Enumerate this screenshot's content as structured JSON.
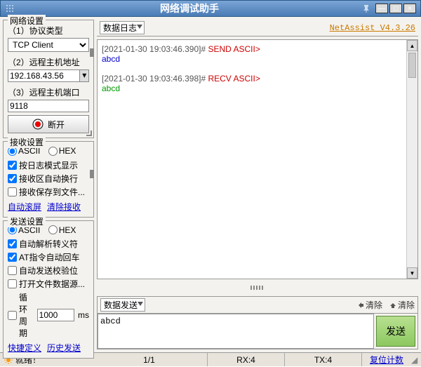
{
  "title": "网络调试助手",
  "version": "NetAssist V4.3.26",
  "net": {
    "group": "网络设置",
    "protoLabel": "（1）协议类型",
    "protoValue": "TCP Client",
    "hostLabel": "（2）远程主机地址",
    "hostValue": "192.168.43.56",
    "portLabel": "（3）远程主机端口",
    "portValue": "9118",
    "disconnect": "断开"
  },
  "recv": {
    "group": "接收设置",
    "ascii": "ASCII",
    "hex": "HEX",
    "logMode": "按日志模式显示",
    "autoWrap": "接收区自动换行",
    "saveFile": "接收保存到文件...",
    "autoScroll": "自动滚屏",
    "clear": "清除接收"
  },
  "send": {
    "group": "发送设置",
    "ascii": "ASCII",
    "hex": "HEX",
    "autoEscape": "自动解析转义符",
    "atEnter": "AT指令自动回车",
    "autoCheck": "自动发送校验位",
    "openFile": "打开文件数据源...",
    "loop": "循环周期",
    "loopVal": "1000",
    "ms": "ms",
    "quickDef": "快捷定义",
    "history": "历史发送"
  },
  "log": {
    "header": "数据日志",
    "line1a": "[2021-01-30 19:03:46.390]# ",
    "line1b": "SEND ASCII>",
    "line2": "abcd",
    "line3a": "[2021-01-30 19:03:46.398]# ",
    "line3b": "RECV ASCII>",
    "line4": "abcd"
  },
  "sendPanel": {
    "header": "数据发送",
    "clearL": "清除",
    "clearR": "清除",
    "input": "abcd",
    "sendBtn": "发送"
  },
  "status": {
    "ready": "就绪！",
    "page": "1/1",
    "rx": "RX:4",
    "tx": "TX:4",
    "reset": "复位计数"
  }
}
